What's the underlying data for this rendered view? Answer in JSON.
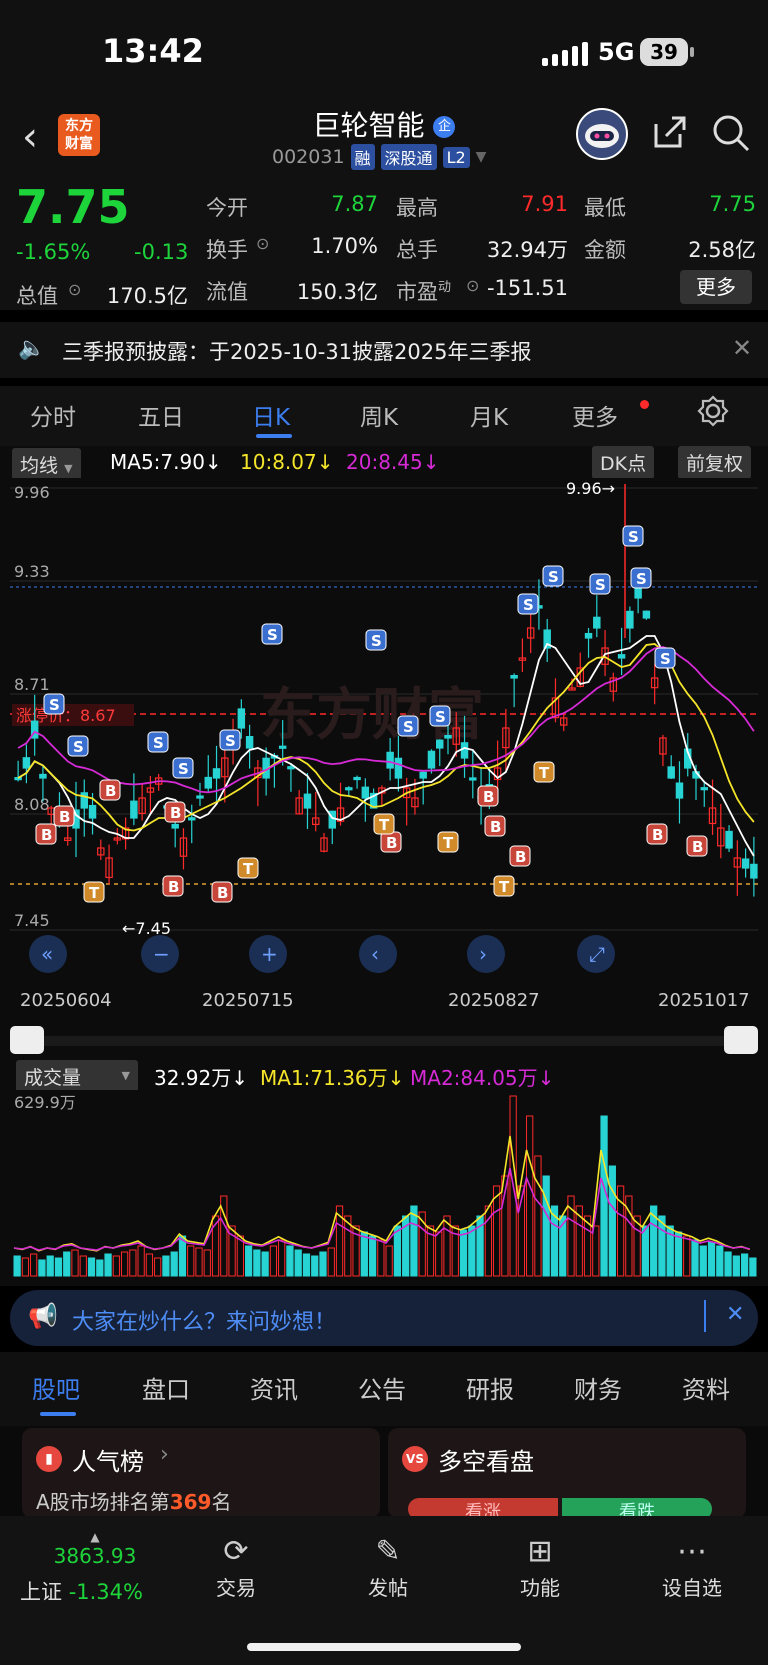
{
  "status_bar": {
    "time": "13:42",
    "network": "5G",
    "battery": "39"
  },
  "header": {
    "logo_line1": "东方",
    "logo_line2": "财富",
    "stock_name": "巨轮智能",
    "stock_badge": "企",
    "code": "002031",
    "tags": [
      "融",
      "深股通",
      "L2"
    ]
  },
  "quote": {
    "price": "7.75",
    "change_pct": "-1.65%",
    "change": "-0.13",
    "open_label": "今开",
    "open": "7.87",
    "high_label": "最高",
    "high": "7.91",
    "low_label": "最低",
    "low": "7.75",
    "turnover_label": "换手",
    "turnover": "1.70%",
    "volume_label": "总手",
    "volume": "32.94万",
    "amount_label": "金额",
    "amount": "2.58亿",
    "mktcap_label": "总值",
    "mktcap": "170.5亿",
    "float_label": "流值",
    "float": "150.3亿",
    "pe_label": "市盈",
    "pe_sup": "动",
    "pe": "-151.51",
    "more": "更多"
  },
  "notice": {
    "text": "三季报预披露：于2025-10-31披露2025年三季报"
  },
  "chart_tabs": [
    "分时",
    "五日",
    "日K",
    "周K",
    "月K",
    "更多"
  ],
  "active_tab": "日K",
  "kline": {
    "indicator": "均线",
    "ma5": "MA5:7.90↓",
    "ma10": "10:8.07↓",
    "ma20": "20:8.45↓",
    "dk": "DK点",
    "adj": "前复权",
    "y_labels": [
      "9.96",
      "9.33",
      "8.71",
      "8.08",
      "7.45"
    ],
    "limit_label": "涨停价：8.67",
    "high_mark": "9.96→",
    "low_mark": "←7.45",
    "dates": [
      "20250604",
      "20250715",
      "20250827",
      "20251017"
    ],
    "watermark": "东方财富"
  },
  "volume": {
    "indicator": "成交量",
    "vol": "32.92万↓",
    "ma1": "MA1:71.36万↓",
    "ma2": "MA2:84.05万↓",
    "max_label": "629.9万"
  },
  "ai_bar": {
    "text": "大家在炒什么？来问妙想！"
  },
  "bottom_tabs": [
    "股吧",
    "盘口",
    "资讯",
    "公告",
    "研报",
    "财务",
    "资料"
  ],
  "active_bottom_tab": "股吧",
  "cards": {
    "popularity_title": "人气榜",
    "rank_prefix": "A股市场排名第",
    "rank": "369",
    "rank_suffix": "名",
    "longshort_title": "多空看盘",
    "bull": "看涨",
    "bear": "看跌"
  },
  "dock": {
    "index_value": "3863.93",
    "index_name": "上证",
    "index_change": "-1.34%",
    "items": [
      "交易",
      "发帖",
      "功能",
      "设自选"
    ]
  },
  "colors": {
    "up": "#ff2a2a",
    "down": "#1ed43b",
    "candle_down": "#27d3d3",
    "ma5": "#ffffff",
    "ma10": "#f5e52a",
    "ma20": "#d52ad5",
    "accent": "#3c7df0"
  }
}
